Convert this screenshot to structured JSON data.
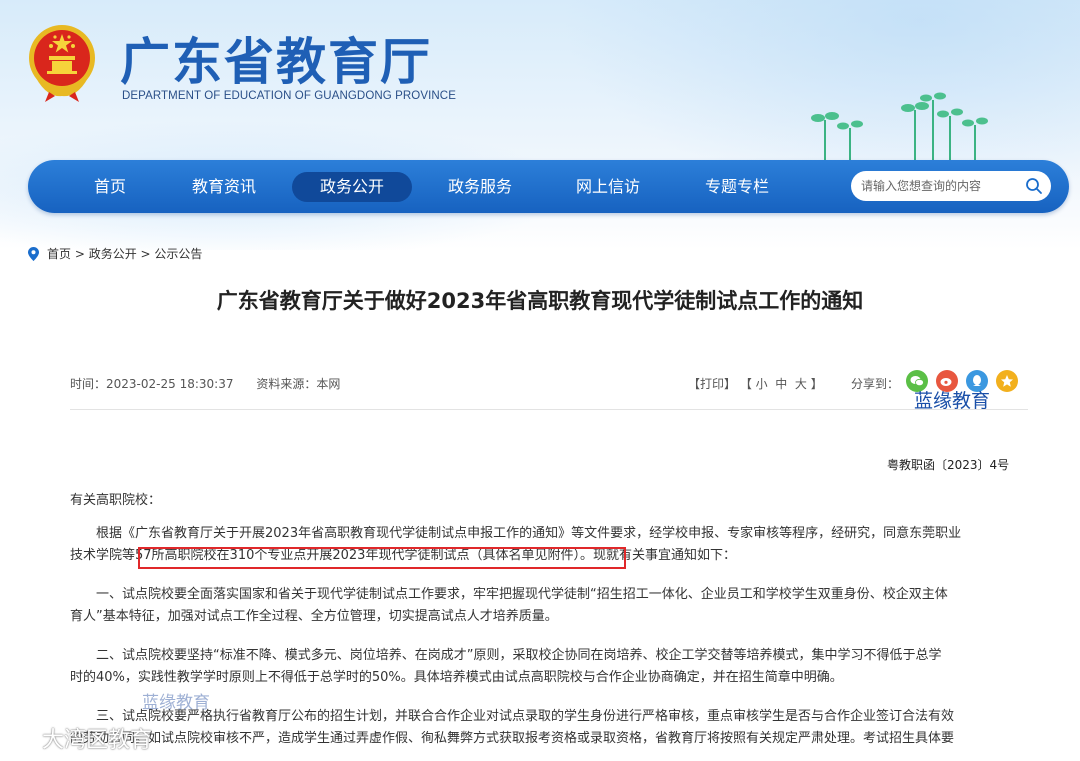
{
  "site": {
    "title": "广东省教育厅",
    "subtitle": "DEPARTMENT OF EDUCATION OF GUANGDONG PROVINCE"
  },
  "nav": {
    "items": [
      {
        "label": "首页"
      },
      {
        "label": "教育资讯"
      },
      {
        "label": "政务公开",
        "active": true
      },
      {
        "label": "政务服务"
      },
      {
        "label": "网上信访"
      },
      {
        "label": "专题专栏"
      }
    ],
    "search_placeholder": "请输入您想查询的内容"
  },
  "breadcrumb": [
    "首页",
    "政务公开",
    "公示公告"
  ],
  "breadcrumb_sep": " > ",
  "article": {
    "title": "广东省教育厅关于做好2023年省高职教育现代学徒制试点工作的通知",
    "time_label": "时间：",
    "time": "2023-02-25 18:30:37",
    "source_label": "资料来源：",
    "source": "本网",
    "tools": "【打印】 【 小  中  大 】",
    "share_label": "分享到：",
    "doc_no": "粤教职函〔2023〕4号",
    "salutation": "有关高职院校：",
    "paragraphs": [
      [
        "根据《广东省教育厅关于开展2023年省高职教育现代学徒制试点申报工作的通知》等文件要求，经学校申报、专家审核等程序，经研究，同意东莞职业",
        "技术学院等57所高职院校在310个专业点开展2023年现代学徒制试点（具体名单见附件）。现就有关事宜通知如下："
      ],
      [
        "一、试点院校要全面落实国家和省关于现代学徒制试点工作要求，牢牢把握现代学徒制“招生招工一体化、企业员工和学校学生双重身份、校企双主体",
        "育人”基本特征，加强对试点工作全过程、全方位管理，切实提高试点人才培养质量。"
      ],
      [
        "二、试点院校要坚持“标准不降、模式多元、岗位培养、在岗成才”原则，采取校企协同在岗培养、校企工学交替等培养模式，集中学习不得低于总学",
        "时的40%，实践性教学学时原则上不得低于总学时的50%。具体培养模式由试点高职院校与合作企业协商确定，并在招生简章中明确。"
      ],
      [
        "三、试点院校要严格执行省教育厅公布的招生计划，并联合合作企业对试点录取的学生身份进行严格审核，重点审核学生是否与合作企业签订合法有效",
        "的劳动合同。如试点院校审核不严，造成学生通过弄虚作假、徇私舞弊方式获取报考资格或录取资格，省教育厅将按照有关规定严肃处理。考试招生具体要"
      ]
    ]
  },
  "watermarks": {
    "primary": "蓝缘教育",
    "secondary": "蓝缘教育",
    "corner": "大湾区教育"
  },
  "colors": {
    "brand_blue": "#1f5fb5",
    "nav_blue": "#1a6dcc",
    "nav_active": "#10499a",
    "highlight_red": "#e0282a"
  }
}
